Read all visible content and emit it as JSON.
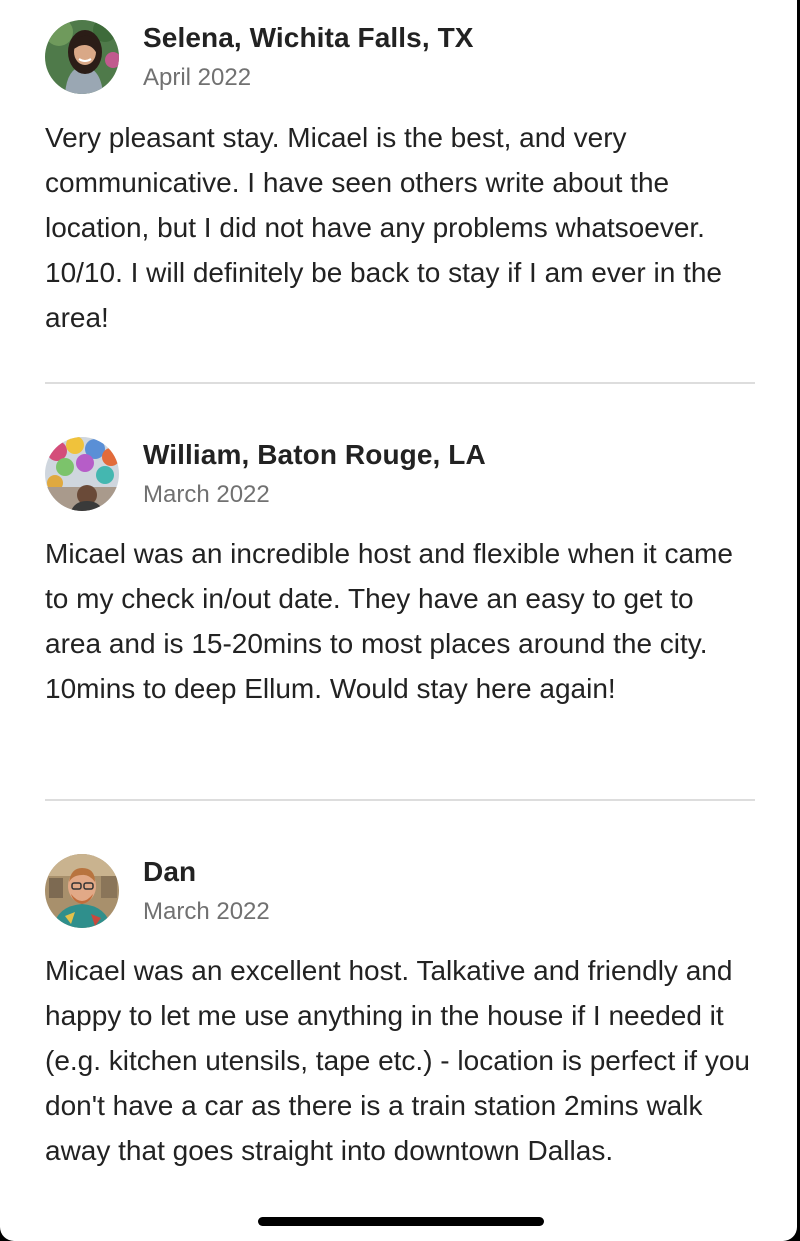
{
  "reviews": [
    {
      "reviewer": "Selena, Wichita Falls, TX",
      "date": "April 2022",
      "text": "Very pleasant stay. Micael is the best, and very communicative. I have seen others write about the location, but I did not have any problems whatsoever. 10/10. I will definitely be back to stay if I am ever in the area!"
    },
    {
      "reviewer": "William, Baton Rouge, LA",
      "date": "March 2022",
      "text": "Micael was an incredible host and flexible when it came to my check in/out date. They have an easy to get to area and is 15-20mins to most places around the city. 10mins to deep Ellum. Would stay here again!"
    },
    {
      "reviewer": "Dan",
      "date": "March 2022",
      "text": "Micael was an excellent host. Talkative and friendly and happy to let me use anything in the house if I needed it (e.g. kitchen utensils, tape etc.) - location is perfect if you don't have a car as there is a train station 2mins walk away that goes straight into downtown Dallas."
    }
  ]
}
